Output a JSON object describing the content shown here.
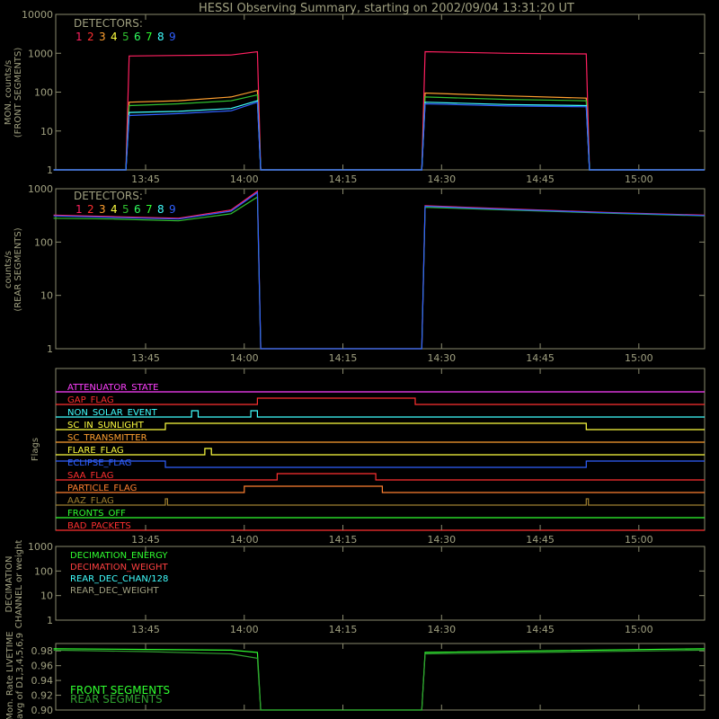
{
  "title": "HESSI Observing Summary, starting on 2002/09/04 13:31:20 UT",
  "colors": {
    "background": "#000000",
    "axes": "#8a8a6e",
    "text": "#a0a080",
    "detectors": [
      "#ff2060",
      "#ff3030",
      "#ffa030",
      "#ffff40",
      "#30c030",
      "#30ff60",
      "#30ff30",
      "#40ffff",
      "#3060ff"
    ]
  },
  "time_axis": {
    "ticks": [
      "13:45",
      "14:00",
      "14:15",
      "14:30",
      "14:45",
      "15:00"
    ]
  },
  "panels": {
    "front": {
      "ylabel_1": "MON. counts/s",
      "ylabel_2": "(FRONT SEGMENTS)",
      "yticks": [
        "10000",
        "1000",
        "100",
        "10",
        "1"
      ],
      "legend_title": "DETECTORS:",
      "detector_labels": [
        "1",
        "2",
        "3",
        "4",
        "5",
        "6",
        "7",
        "8",
        "9"
      ]
    },
    "rear": {
      "ylabel_1": "counts/s",
      "ylabel_2": "(REAR SEGMENTS)",
      "yticks": [
        "1000",
        "100",
        "10",
        "1"
      ],
      "legend_title": "DETECTORS:",
      "detector_labels": [
        "1",
        "2",
        "3",
        "4",
        "5",
        "6",
        "7",
        "8",
        "9"
      ]
    },
    "flags": {
      "ylabel": "Flags"
    },
    "decimation": {
      "ylabel_1": "DECIMATION",
      "ylabel_2": "CHANNEL or weight",
      "yticks": [
        "1000",
        "100",
        "10",
        "1"
      ],
      "legend": [
        {
          "label": "DECIMATION_ENERGY",
          "color": "#30ff30"
        },
        {
          "label": "DECIMATION_WEIGHT",
          "color": "#ff4040"
        },
        {
          "label": "REAR_DEC_CHAN/128",
          "color": "#40ffff"
        },
        {
          "label": "REAR_DEC_WEIGHT",
          "color": "#a0a080"
        }
      ]
    },
    "livetime": {
      "ylabel_1": "Mon. Rate LIVETIME",
      "ylabel_2": "avg of D1,3,4,5,6,9",
      "yticks": [
        "0.98",
        "0.96",
        "0.94",
        "0.92",
        "0.90"
      ],
      "legend": [
        {
          "label": "FRONT SEGMENTS",
          "color": "#30ff30"
        },
        {
          "label": "REAR SEGMENTS",
          "color": "#30a030"
        }
      ]
    }
  },
  "chart_data": [
    {
      "type": "line",
      "title": "HESSI Observing Summary, starting on 2002/09/04 13:31:20 UT",
      "panel": "front",
      "x_unit": "UT",
      "xlim": [
        "13:31:20",
        "15:10"
      ],
      "y_scale": "log",
      "ylim": [
        1,
        10000
      ],
      "series": [
        {
          "name": "1",
          "color": "#ff2060",
          "x": [
            "13:31",
            "13:42",
            "13:42:30",
            "13:50",
            "13:58",
            "14:02",
            "14:02:30",
            "14:27",
            "14:27:30",
            "14:40",
            "14:52",
            "14:52:30",
            "15:10"
          ],
          "y": [
            1,
            1,
            850,
            880,
            900,
            1100,
            1,
            1,
            1100,
            1000,
            960,
            1,
            1
          ]
        },
        {
          "name": "3",
          "color": "#ffa030",
          "x": [
            "13:31",
            "13:42",
            "13:42:30",
            "13:50",
            "13:58",
            "14:02",
            "14:02:30",
            "14:27",
            "14:27:30",
            "14:40",
            "14:52",
            "14:52:30",
            "15:10"
          ],
          "y": [
            1,
            1,
            55,
            60,
            75,
            110,
            1,
            1,
            95,
            80,
            70,
            1,
            1
          ]
        },
        {
          "name": "5",
          "color": "#30c030",
          "x": [
            "13:31",
            "13:42",
            "13:42:30",
            "13:50",
            "13:58",
            "14:02",
            "14:02:30",
            "14:27",
            "14:27:30",
            "14:40",
            "14:52",
            "14:52:30",
            "15:10"
          ],
          "y": [
            1,
            1,
            45,
            50,
            60,
            85,
            1,
            1,
            75,
            65,
            60,
            1,
            1
          ]
        },
        {
          "name": "8",
          "color": "#40ffff",
          "x": [
            "13:31",
            "13:42",
            "13:42:30",
            "13:50",
            "13:58",
            "14:02",
            "14:02:30",
            "14:27",
            "14:27:30",
            "14:40",
            "14:52",
            "14:52:30",
            "15:10"
          ],
          "y": [
            1,
            1,
            30,
            32,
            38,
            60,
            1,
            1,
            55,
            48,
            45,
            1,
            1
          ]
        },
        {
          "name": "9",
          "color": "#3060ff",
          "x": [
            "13:31",
            "13:42",
            "13:42:30",
            "13:50",
            "13:58",
            "14:02",
            "14:02:30",
            "14:27",
            "14:27:30",
            "14:40",
            "14:52",
            "14:52:30",
            "15:10"
          ],
          "y": [
            1,
            1,
            25,
            28,
            33,
            55,
            1,
            1,
            50,
            44,
            42,
            1,
            1
          ]
        }
      ]
    },
    {
      "type": "line",
      "panel": "rear",
      "x_unit": "UT",
      "xlim": [
        "13:31:20",
        "15:10"
      ],
      "y_scale": "log",
      "ylim": [
        1,
        1000
      ],
      "series": [
        {
          "name": "1",
          "color": "#ff2060",
          "x": [
            "13:31",
            "13:40",
            "13:50",
            "13:58",
            "14:02",
            "14:02:30",
            "14:27",
            "14:27:30",
            "14:40",
            "14:55",
            "15:10"
          ],
          "y": [
            320,
            300,
            280,
            400,
            900,
            1,
            1,
            480,
            420,
            360,
            320
          ]
        },
        {
          "name": "5",
          "color": "#30c030",
          "x": [
            "13:31",
            "13:40",
            "13:50",
            "13:58",
            "14:02",
            "14:02:30",
            "14:27",
            "14:27:30",
            "14:40",
            "14:55",
            "15:10"
          ],
          "y": [
            280,
            270,
            250,
            340,
            700,
            1,
            1,
            450,
            400,
            350,
            310
          ]
        },
        {
          "name": "9",
          "color": "#3060ff",
          "x": [
            "13:31",
            "13:40",
            "13:50",
            "13:58",
            "14:02",
            "14:02:30",
            "14:27",
            "14:27:30",
            "14:40",
            "14:55",
            "15:10"
          ],
          "y": [
            310,
            290,
            270,
            380,
            850,
            1,
            1,
            470,
            410,
            355,
            315
          ]
        }
      ]
    },
    {
      "type": "line",
      "panel": "flags",
      "flags": [
        {
          "label": "ATTENUATOR_STATE",
          "color": "#ff40ff",
          "high_intervals": []
        },
        {
          "label": "GAP_FLAG",
          "color": "#ff3030",
          "high_intervals": [
            [
              "14:02",
              "14:26"
            ]
          ]
        },
        {
          "label": "NON_SOLAR_EVENT",
          "color": "#40ffff",
          "high_intervals": [
            [
              "13:52",
              "13:53"
            ],
            [
              "14:01",
              "14:02"
            ]
          ]
        },
        {
          "label": "SC_IN_SUNLIGHT",
          "color": "#ffff40",
          "high_intervals": [
            [
              "13:48",
              "14:52"
            ]
          ]
        },
        {
          "label": "SC_TRANSMITTER",
          "color": "#ffa030",
          "high_intervals": []
        },
        {
          "label": "FLARE_FLAG",
          "color": "#ffff40",
          "high_intervals": [
            [
              "13:54",
              "13:55"
            ]
          ]
        },
        {
          "label": "ECLIPSE_FLAG",
          "color": "#3060ff",
          "high_intervals": [
            [
              "13:31",
              "13:48"
            ],
            [
              "14:52",
              "15:10"
            ]
          ]
        },
        {
          "label": "SAA_FLAG",
          "color": "#ff3030",
          "high_intervals": [
            [
              "14:05",
              "14:20"
            ]
          ]
        },
        {
          "label": "PARTICLE_FLAG",
          "color": "#ff8030",
          "high_intervals": [
            [
              "14:00",
              "14:21"
            ]
          ]
        },
        {
          "label": "AAZ_FLAG",
          "color": "#a08030",
          "high_intervals": [
            [
              "13:48",
              "13:48:20"
            ],
            [
              "14:52",
              "14:52:20"
            ]
          ]
        },
        {
          "label": "FRONTS_OFF",
          "color": "#30ff30",
          "high_intervals": []
        },
        {
          "label": "BAD_PACKETS",
          "color": "#ff3030",
          "high_intervals": []
        }
      ]
    },
    {
      "type": "line",
      "panel": "decimation",
      "y_scale": "log",
      "ylim": [
        1,
        1000
      ],
      "series": []
    },
    {
      "type": "line",
      "panel": "livetime",
      "ylim": [
        0.9,
        0.99
      ],
      "series": [
        {
          "name": "FRONT SEGMENTS",
          "color": "#30ff30",
          "x": [
            "13:31",
            "13:45",
            "13:58",
            "14:02",
            "14:02:30",
            "14:27",
            "14:27:30",
            "14:45",
            "15:10"
          ],
          "y": [
            0.983,
            0.982,
            0.981,
            0.978,
            0.9,
            0.9,
            0.978,
            0.98,
            0.983
          ]
        },
        {
          "name": "REAR SEGMENTS",
          "color": "#30a030",
          "x": [
            "13:31",
            "13:45",
            "13:58",
            "14:02",
            "14:02:30",
            "14:27",
            "14:27:30",
            "14:45",
            "15:10"
          ],
          "y": [
            0.981,
            0.979,
            0.976,
            0.97,
            0.9,
            0.9,
            0.976,
            0.978,
            0.981
          ]
        }
      ]
    }
  ]
}
